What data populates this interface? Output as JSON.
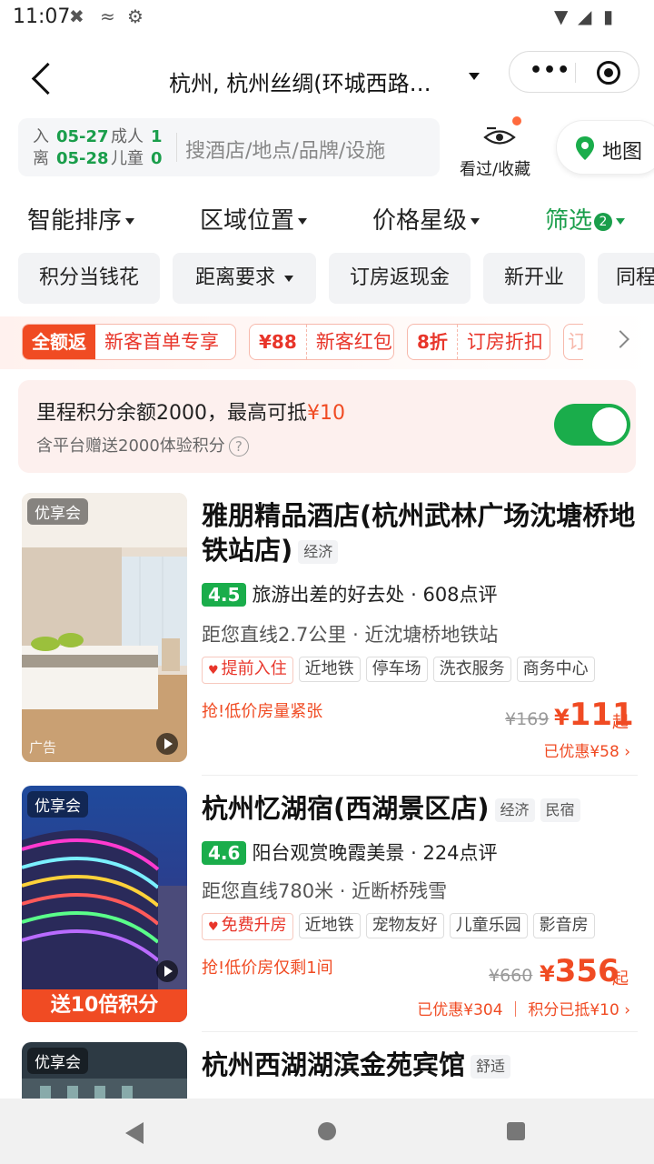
{
  "status": {
    "time": "11:07"
  },
  "nav": {
    "title": "杭州, 杭州丝绸(环城西路…"
  },
  "search": {
    "checkin_label": "入",
    "checkin_date": "05-27",
    "checkout_label": "离",
    "checkout_date": "05-28",
    "adults_label": "成人",
    "adults": "1",
    "children_label": "儿童",
    "children": "0",
    "placeholder": "搜酒店/地点/品牌/设施",
    "history_label": "看过/收藏",
    "map_label": "地图"
  },
  "sort": {
    "items": [
      "智能排序",
      "区域位置",
      "价格星级",
      "筛选"
    ],
    "filter_count": "2"
  },
  "chips": [
    "积分当钱花",
    "距离要求",
    "订房返现金",
    "新开业",
    "同程"
  ],
  "promo": [
    {
      "left": "全额返",
      "right": "新客首单专享"
    },
    {
      "left": "¥88",
      "right": "新客红包"
    },
    {
      "left": "8折",
      "right": "订房折扣"
    },
    {
      "left": "订",
      "right": ""
    }
  ],
  "miles": {
    "line1_prefix": "里程积分余额2000，最高可抵",
    "line1_amount": "¥10",
    "line2": "含平台赠送2000体验积分",
    "toggle_on": true
  },
  "hotels": [
    {
      "badge": "优享会",
      "ad": "广告",
      "name": "雅朋精品酒店(杭州武林广场沈塘桥地铁站店)",
      "levels": [
        "经济"
      ],
      "score": "4.5",
      "review_text": "旅游出差的好去处 · 608点评",
      "distance": "距您直线2.7公里 · 近沈塘桥地铁站",
      "tags": [
        "提前入住",
        "近地铁",
        "停车场",
        "洗衣服务",
        "商务中心"
      ],
      "urgent": "抢!低价房量紧张",
      "old_price": "¥169",
      "currency": "¥",
      "price": "111",
      "qi": "起",
      "saved": "已优惠¥58 ›"
    },
    {
      "badge": "优享会",
      "points_banner": "送10倍积分",
      "name": "杭州忆湖宿(西湖景区店)",
      "levels": [
        "经济",
        "民宿"
      ],
      "score": "4.6",
      "review_text": "阳台观赏晚霞美景 · 224点评",
      "distance": "距您直线780米 · 近断桥残雪",
      "tags": [
        "免费升房",
        "近地铁",
        "宠物友好",
        "儿童乐园",
        "影音房"
      ],
      "urgent": "抢!低价房仅剩1间",
      "old_price": "¥660",
      "currency": "¥",
      "price": "356",
      "qi": "起",
      "saved": "已优惠¥304 ｜ 积分已抵¥10 ›"
    },
    {
      "badge": "优享会",
      "name": "杭州西湖湖滨金苑宾馆",
      "levels": [
        "舒适"
      ]
    }
  ]
}
